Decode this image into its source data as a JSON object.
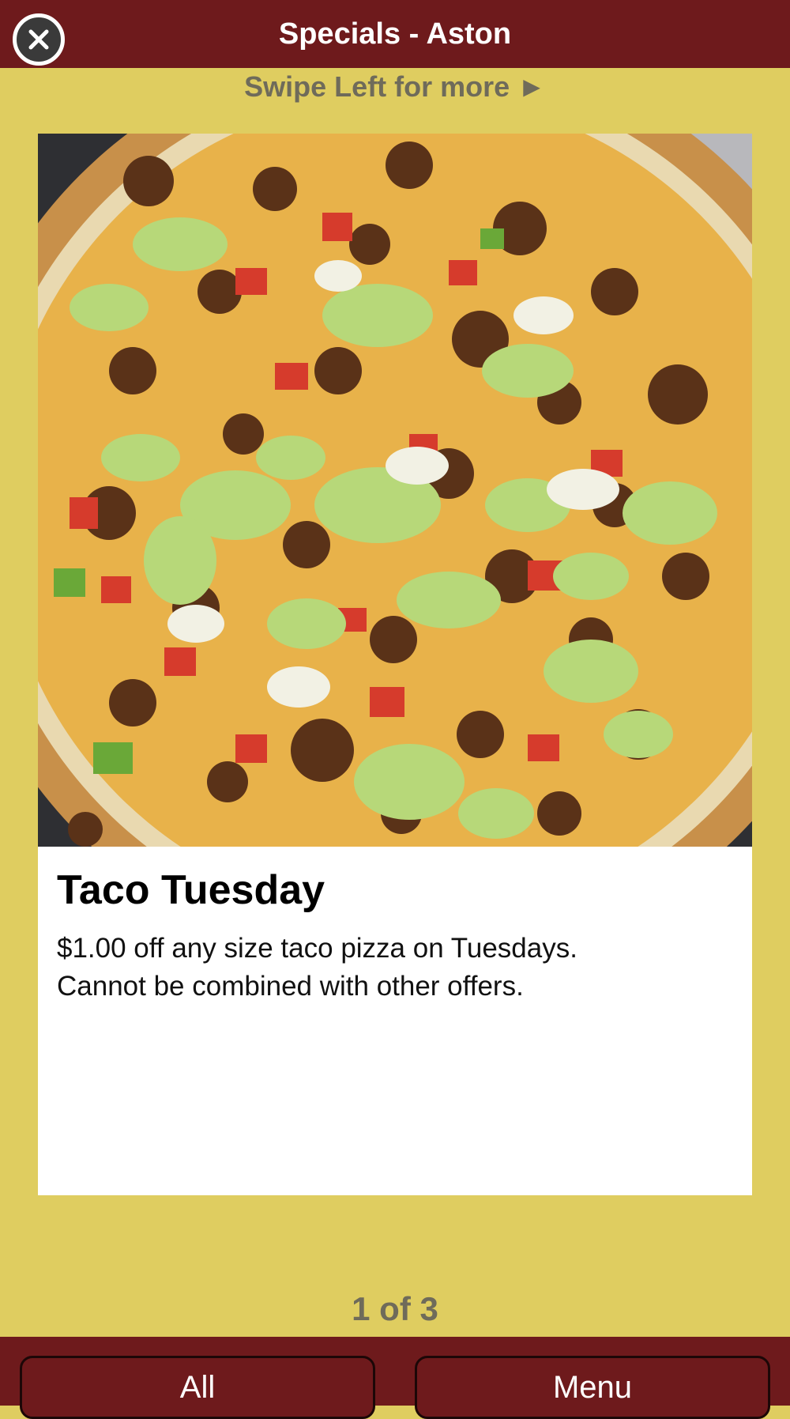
{
  "header": {
    "title": "Specials - Aston",
    "close_icon": "close-icon"
  },
  "swipe_hint": "Swipe Left for more ►",
  "special": {
    "image_icon": "taco-pizza-photo",
    "title": "Taco Tuesday",
    "description_line1": "$1.00 off any size taco pizza on Tuesdays.",
    "description_line2": "Cannot be combined with other offers."
  },
  "pager": "1 of 3",
  "footer": {
    "all_label": "All",
    "menu_label": "Menu"
  },
  "colors": {
    "bar": "#6e1a1c",
    "background": "#dfcd60",
    "card": "#ffffff"
  }
}
